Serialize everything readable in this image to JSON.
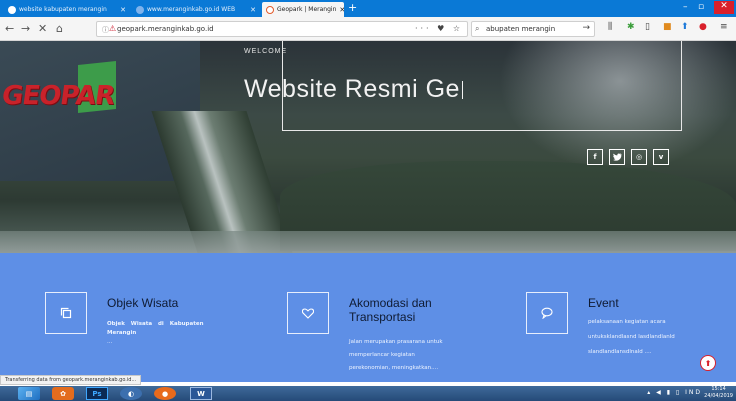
{
  "browser": {
    "tabs": [
      {
        "title": "website kabupaten merangin",
        "active": false
      },
      {
        "title": "www.meranginkab.go.id WEB",
        "active": false
      },
      {
        "title": "Geopark | Merangin",
        "active": true
      }
    ],
    "new_tab_label": "+",
    "url": "geopark.meranginkab.go.id",
    "search_value": "abupaten merangin",
    "status_text": "Transferring data from geopark.meranginkab.go.id..."
  },
  "hero": {
    "welcome": "WELCOME",
    "title": "Website Resmi Ge",
    "sign_text": "GEOPAR",
    "socials": [
      "f",
      "t",
      "ig",
      "v"
    ]
  },
  "services": [
    {
      "title_lines": [
        "Objek Wisata"
      ],
      "desc_lines": [
        "Objek Wisata di Kabupaten",
        "Merangin",
        "..."
      ],
      "icon": "copy-icon"
    },
    {
      "title_lines": [
        "Akomodasi dan",
        "Transportasi"
      ],
      "desc_lines": [
        "Jalan merupakan prasarana untuk",
        "memperlancar kegiatan",
        "perekonomian, meningkatkan...."
      ],
      "icon": "heart-icon"
    },
    {
      "title_lines": [
        "Event"
      ],
      "desc_lines": [
        "pelaksanaan kegiatan acara",
        "untuksklandlasnd lasdlandlanld",
        "slandlandlansdlnald ...."
      ],
      "icon": "chat-bubble-icon"
    }
  ],
  "taskbar": {
    "apps": [
      "Ps",
      "W"
    ],
    "tray_lang": "IND",
    "time": "15:14",
    "date": "24/04/2019"
  },
  "colors": {
    "tabstrip": "#0a79d6",
    "services_bg": "#5e8fe6",
    "accent_red": "#d9202b"
  }
}
